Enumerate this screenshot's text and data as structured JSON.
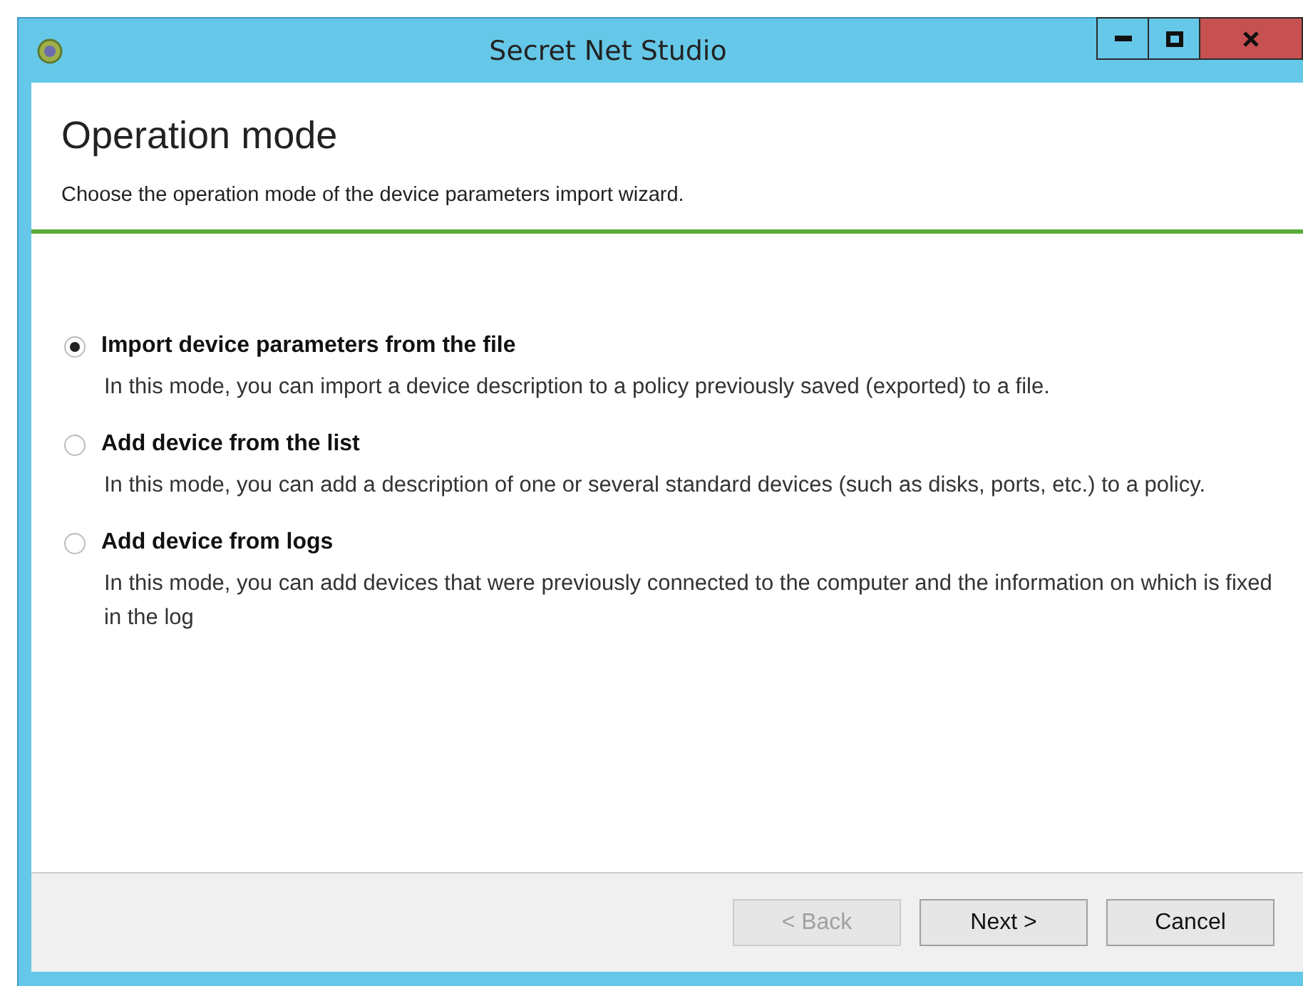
{
  "window": {
    "title": "Secret Net Studio"
  },
  "header": {
    "title": "Operation mode",
    "subtitle": "Choose the operation mode of the device parameters import wizard."
  },
  "options": [
    {
      "label": "Import device parameters from the file",
      "description": "In this mode, you can import a device description to a policy previously saved (exported) to a file.",
      "selected": true
    },
    {
      "label": "Add device from the list",
      "description": "In this mode, you can add a description of one or several standard devices (such as disks, ports, etc.) to a policy.",
      "selected": false
    },
    {
      "label": "Add device from logs",
      "description": "In this mode, you can add devices that were previously connected to the computer and the information on which is fixed in the log",
      "selected": false
    }
  ],
  "buttons": [
    {
      "label": "< Back",
      "disabled": true
    },
    {
      "label": "Next >",
      "disabled": false
    },
    {
      "label": "Cancel",
      "disabled": false
    }
  ]
}
